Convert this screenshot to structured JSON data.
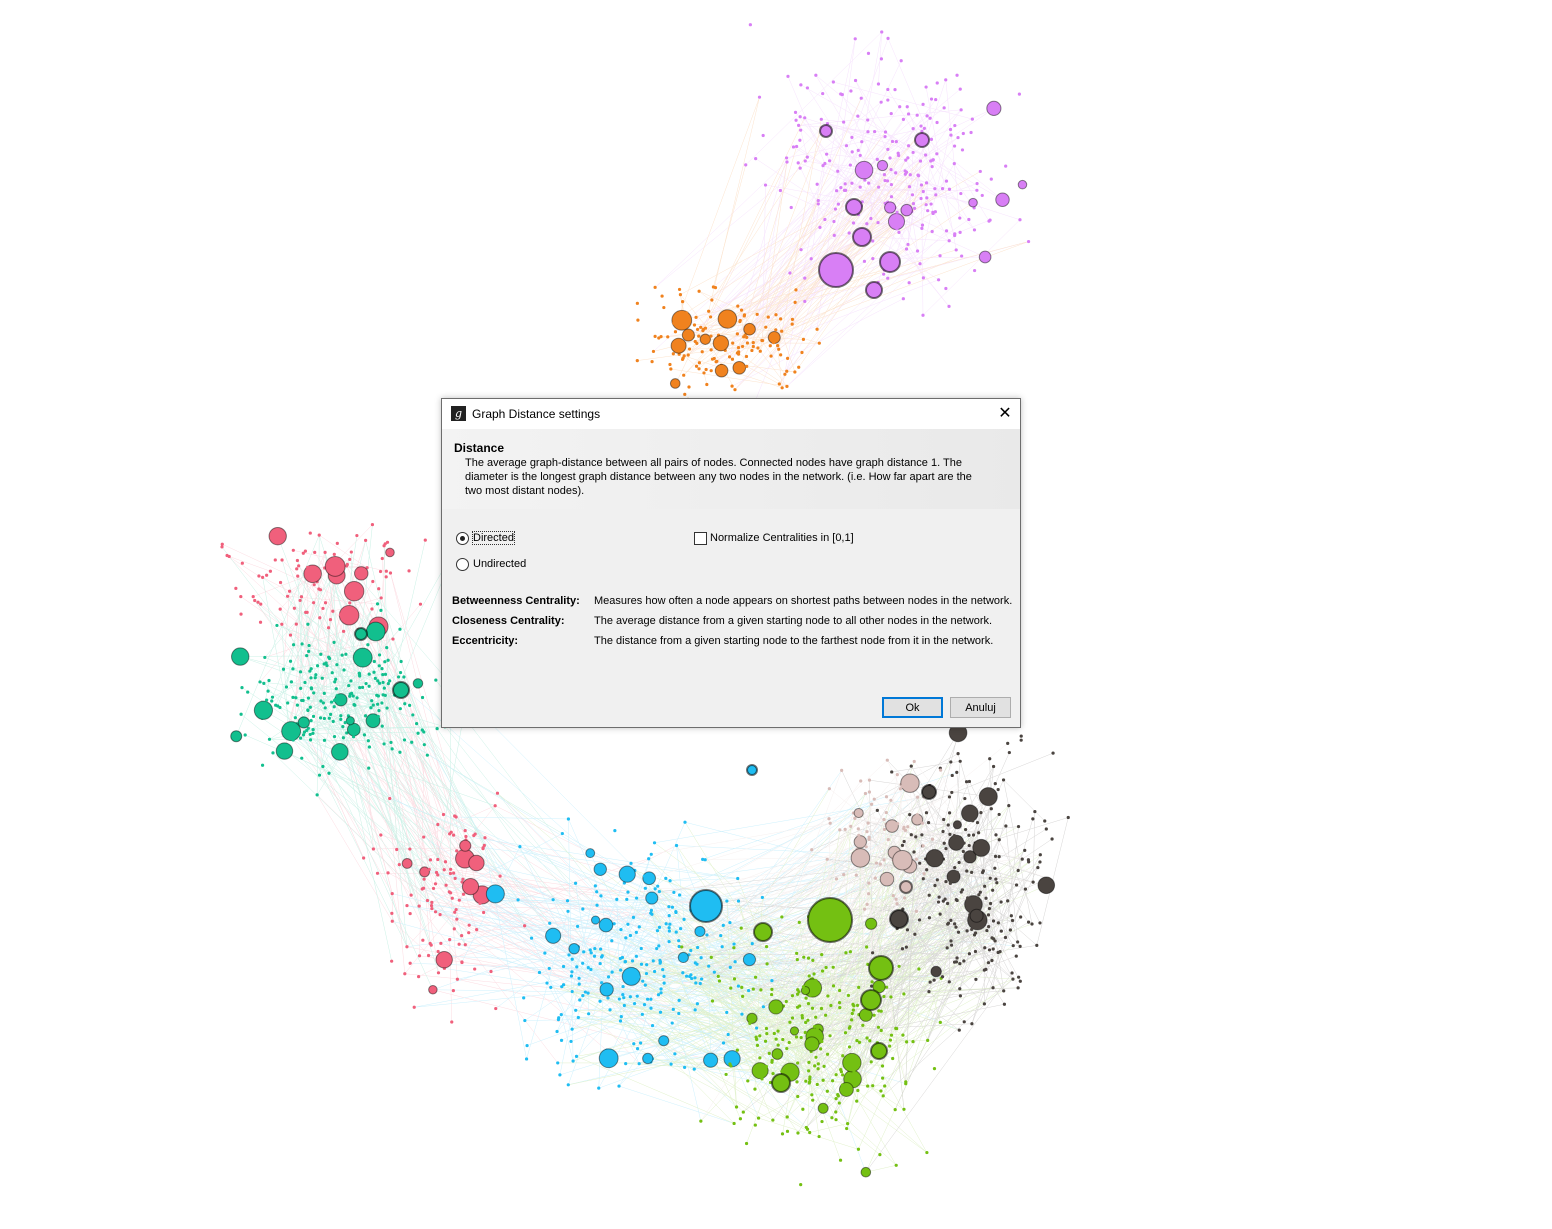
{
  "dialog": {
    "title": "Graph Distance settings",
    "close_glyph": "✕",
    "header": {
      "title": "Distance",
      "description": "The average graph-distance between all pairs of nodes. Connected nodes have graph distance 1. The diameter is the longest graph distance between any two nodes in the network. (i.e.  How far apart are the two most distant nodes)."
    },
    "options": {
      "directed_label": "Directed",
      "undirected_label": "Undirected",
      "selected": "Directed",
      "normalize_label": "Normalize Centralities in [0,1]",
      "normalize_checked": false
    },
    "metrics": [
      {
        "name": "Betweenness Centrality:",
        "description": "Measures how often a node appears on shortest paths between nodes in the network."
      },
      {
        "name": "Closeness Centrality:",
        "description": "The average distance from a given starting node to all other nodes in the network."
      },
      {
        "name": "Eccentricity:",
        "description": "The distance from a given starting node to the farthest node from it in the network."
      }
    ],
    "ok_label": "Ok",
    "cancel_label": "Anuluj"
  },
  "graph": {
    "cluster_colors": {
      "purple": "#d87ff5",
      "orange": "#f0821e",
      "pink": "#f0607c",
      "teal": "#12bf8e",
      "blue": "#1fbdf2",
      "green": "#74c012",
      "dark": "#4a4440",
      "beige": "#d8bcb8"
    }
  }
}
